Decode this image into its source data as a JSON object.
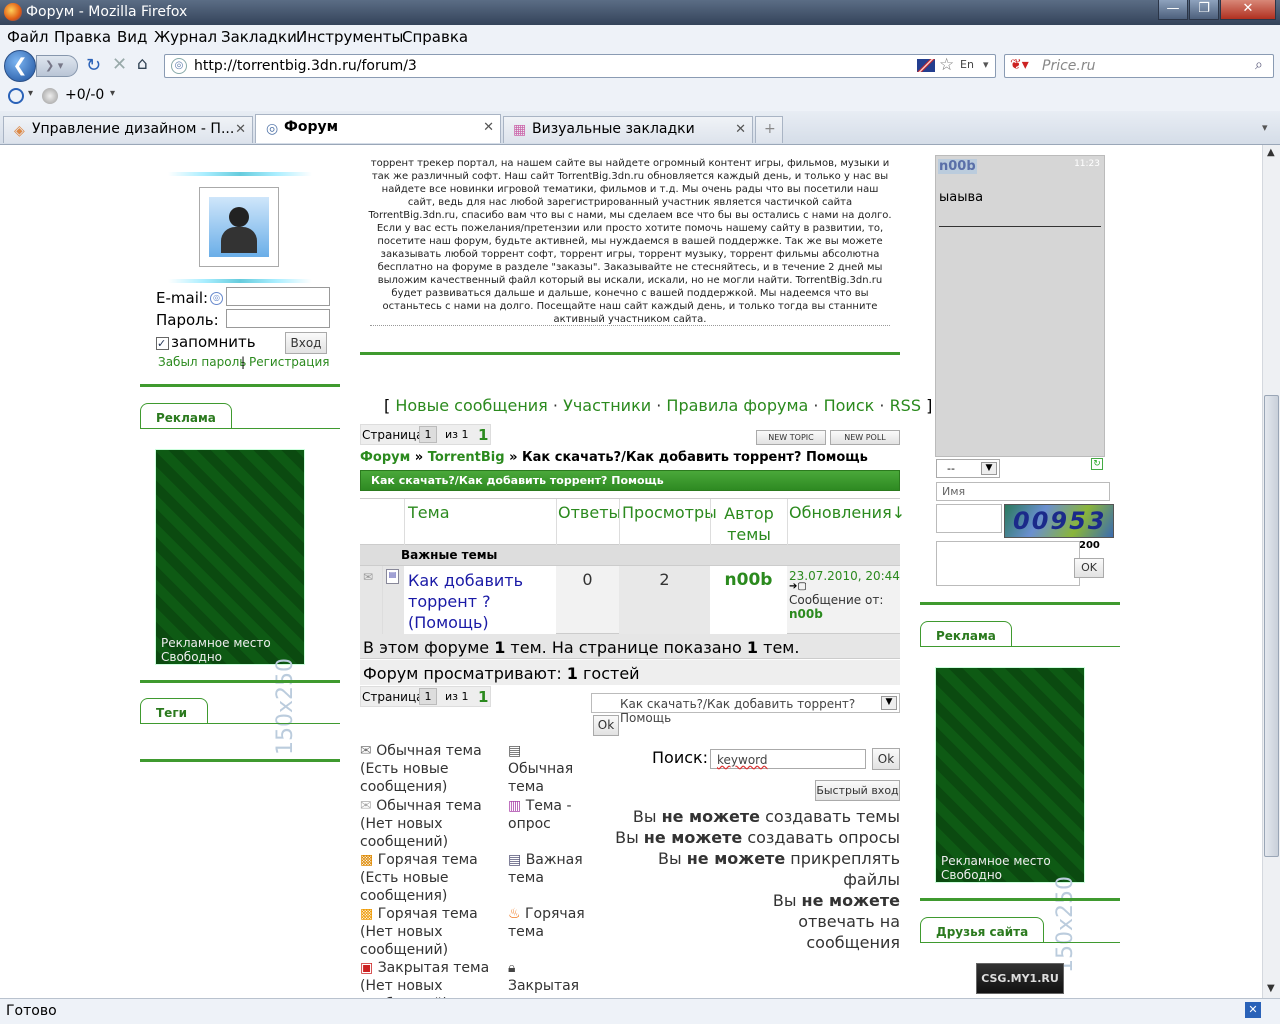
{
  "window": {
    "title": "Форум - Mozilla Firefox",
    "min": "—",
    "max": "❐",
    "close": "✕"
  },
  "menu": [
    "Файл",
    "Правка",
    "Вид",
    "Журнал",
    "Закладки",
    "Инструменты",
    "Справка"
  ],
  "nav": {
    "url": "http://torrentbig.3dn.ru/forum/3",
    "search_placeholder": "Price.ru"
  },
  "bookbar": {
    "counter": "+0/-0"
  },
  "tabs": [
    {
      "label": "Управление дизайном - П...",
      "close": "✕"
    },
    {
      "label": "Форум",
      "close": "✕"
    },
    {
      "label": "Визуальные закладки",
      "close": "✕"
    },
    {
      "label": "+"
    }
  ],
  "status": {
    "text": "Готово"
  },
  "left": {
    "email_label": "E-mail:",
    "password_label": "Пароль:",
    "remember": "запомнить",
    "login_btn": "Вход",
    "forgot": "Забыл пароль",
    "sep": "|",
    "register": "Регистрация",
    "ad_title": "Реклама",
    "ad_text1": "Рекламное место",
    "ad_text2": "Свободно",
    "ad_size": "150x250",
    "tags_title": "Теги"
  },
  "intro": "торрент трекер портал, на нашем сайте вы найдете огромный контент игры, фильмов, музыки и так же различный софт. Наш сайт TorrentBig.3dn.ru обновляется каждый день, и только у нас вы найдете все новинки игровой тематики, фильмов и т.д. Мы очень рады что вы посетили наш сайт, ведь для нас любой зарегистрированный участник является частичкой сайта TorrentBig.3dn.ru, спасибо вам что вы с нами, мы сделаем все что бы вы остались с нами на долго. Если у вас есть пожелания/претензии или просто хотите помочь нашему сайту в развитии, то, посетите наш форум, будьте активней, мы нуждаемся в вашей поддержке. Так же вы можете заказывать любой торрент софт, торрент игры, торрент музыку, торрент фильмы абсолютна бесплатно на форуме в разделе \"заказы\". Заказывайте не стесняйтесь, и в течение 2 дней мы выложим качественный файл который вы искали, искали, но не могли найти. TorrentBig.3dn.ru будет развиваться дальше и дальше, конечно с вашей поддержкой. Мы надеемся что вы останьтесь с нами на долго. Посещайте наш сайт каждый день, и только тогда вы станните активный участником сайта.",
  "forum_nav": {
    "open": "[",
    "close": "]",
    "dot": "·",
    "links": [
      "Новые сообщения",
      "Участники",
      "Правила форума",
      "Поиск",
      "RSS"
    ]
  },
  "paging": {
    "page_label": "Страница",
    "page": "1",
    "of": "из 1",
    "current": "1",
    "new_topic": "NEW TOPIC",
    "new_poll": "NEW POLL"
  },
  "breadcrumb": {
    "forum": "Форум",
    "sep1": "»",
    "site": "TorrentBig",
    "sep2": "»",
    "current": "Как скачать?/Как добавить торрент? Помощь"
  },
  "section_header": "Как скачать?/Как добавить торрент? Помощь",
  "table": {
    "headers": [
      "Тема",
      "Ответы",
      "Просмотры",
      "Автор темы",
      "Обновления↓"
    ],
    "important": "Важные темы",
    "row": {
      "title": "Как добавить торрент ? (Помощь)",
      "replies": "0",
      "views": "2",
      "author": "n00b",
      "date": "23.07.2010, 20:44",
      "msg_from": "Сообщение от:",
      "msg_author": "n00b"
    }
  },
  "summary": {
    "t1": "В этом форуме ",
    "n1": "1",
    "t2": " тем. На странице показано ",
    "n2": "1",
    "t3": " тем.",
    "viewers_label": "Форум просматривают: ",
    "viewers_n": "1",
    "viewers_unit": " гостей"
  },
  "jump": {
    "select": "Как скачать?/Как добавить торрент? Помощь",
    "ok": "Ok"
  },
  "legend_left": [
    "Обычная тема (Есть новые сообщения)",
    "Обычная тема (Нет новых сообщений)",
    "Горячая тема (Есть новые сообщения)",
    "Горячая тема (Нет новых сообщений)",
    "Закрытая тема (Нет новых сообщений)"
  ],
  "legend_right": [
    "Обычная тема",
    "Тема - опрос",
    "Важная тема",
    "Горячая тема",
    "Закрытая"
  ],
  "search": {
    "label": "Поиск:",
    "value": "keyword",
    "ok": "Ok",
    "quick_login": "Быстрый вход"
  },
  "perms": [
    {
      "a": "Вы ",
      "b": "не можете",
      "c": " создавать темы"
    },
    {
      "a": "Вы ",
      "b": "не можете",
      "c": " создавать опросы"
    },
    {
      "a": "Вы ",
      "b": "не можете",
      "c": " прикреплять файлы"
    },
    {
      "a": "Вы ",
      "b": "не можете",
      "c": " отвечать на сообщения"
    }
  ],
  "right": {
    "chat_user": "n00b",
    "chat_time": "11:23",
    "chat_msg": "ыаыва",
    "select": "--",
    "name_placeholder": "Имя",
    "captcha": "00953",
    "counter": "200",
    "ok": "OK",
    "ad_title": "Реклама",
    "ad_text1": "Рекламное место",
    "ad_text2": "Свободно",
    "ad_size": "150x250",
    "friends_title": "Друзья сайта",
    "friend_banner": "CSG.MY1.RU"
  },
  "colors": {
    "accent": "#2b8a1e",
    "link": "#1a1aa6"
  }
}
